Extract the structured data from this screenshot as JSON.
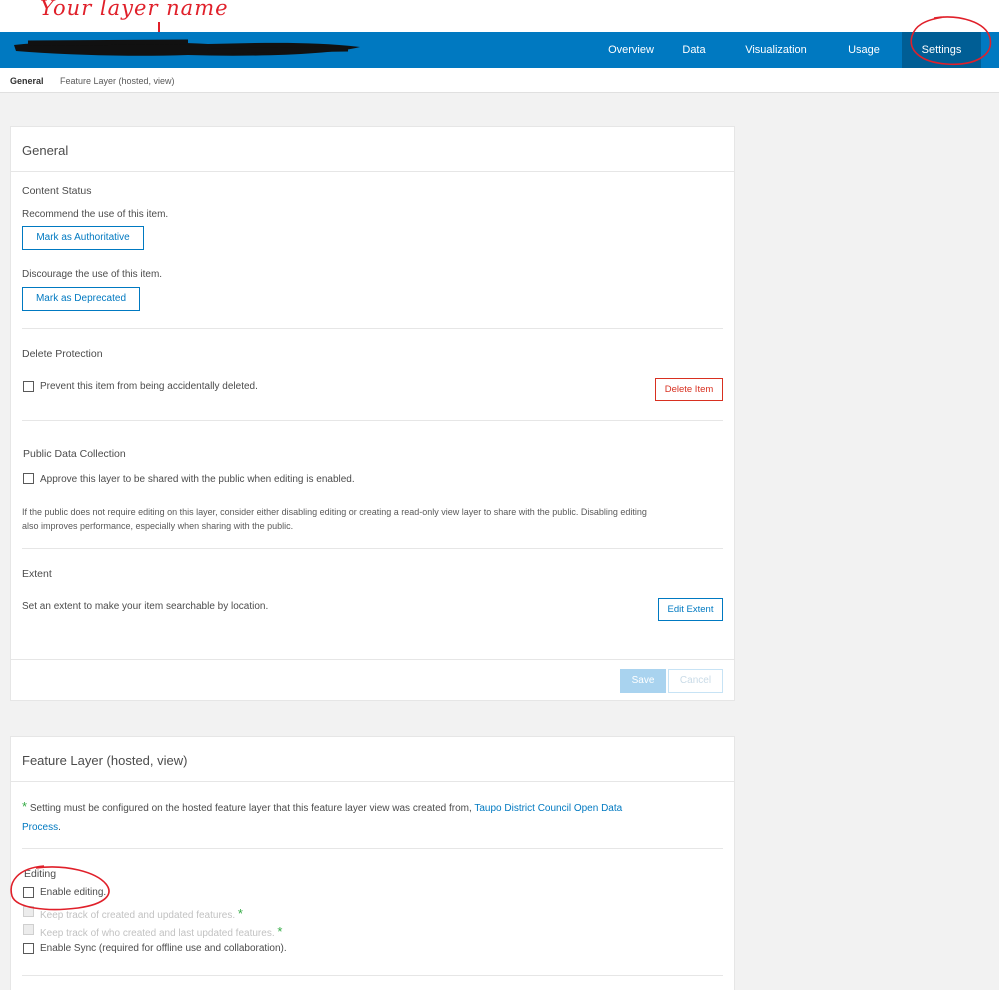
{
  "annotation": {
    "text": "Your layer name"
  },
  "nav": {
    "items": [
      {
        "label": "Overview"
      },
      {
        "label": "Data"
      },
      {
        "label": "Visualization"
      },
      {
        "label": "Usage"
      },
      {
        "label": "Settings",
        "active": true
      }
    ]
  },
  "breadcrumb": {
    "current": "General",
    "other": "Feature Layer (hosted, view)"
  },
  "general": {
    "title": "General",
    "content_status": {
      "heading": "Content Status",
      "recommend_text": "Recommend the use of this item.",
      "authoritative_button": "Mark as Authoritative",
      "discourage_text": "Discourage the use of this item.",
      "deprecated_button": "Mark as Deprecated"
    },
    "delete_protection": {
      "heading": "Delete Protection",
      "checkbox_label": "Prevent this item from being accidentally deleted.",
      "delete_button": "Delete Item"
    },
    "public_data": {
      "heading": "Public Data Collection",
      "checkbox_label": "Approve this layer to be shared with the public when editing is enabled.",
      "note_line1": "If the public does not require editing on this layer, consider either disabling editing or creating a read-only view layer to share with the public. Disabling editing",
      "note_line2": "also improves performance, especially when sharing with the public."
    },
    "extent": {
      "heading": "Extent",
      "text": "Set an extent to make your item searchable by location.",
      "edit_button": "Edit Extent"
    },
    "save_button": "Save",
    "cancel_button": "Cancel"
  },
  "feature_layer": {
    "title": "Feature Layer (hosted, view)",
    "star": "*",
    "note_text": "Setting must be configured on the hosted feature layer that this feature layer view was created from,",
    "note_link_part1": "Taupo District Council Open Data",
    "note_link_part2": "Process",
    "note_end": ".",
    "editing": {
      "heading": "Editing",
      "enable_editing": "Enable editing.",
      "keep_track_features": "Keep track of created and updated features.",
      "keep_track_who": "Keep track of who created and last updated features.",
      "enable_sync": "Enable Sync (required for offline use and collaboration)."
    }
  },
  "colors": {
    "nav_bg": "#0079c1",
    "nav_active": "#005e95",
    "accent": "#0079c1",
    "danger": "#d83020",
    "annotation": "#e0202a"
  }
}
